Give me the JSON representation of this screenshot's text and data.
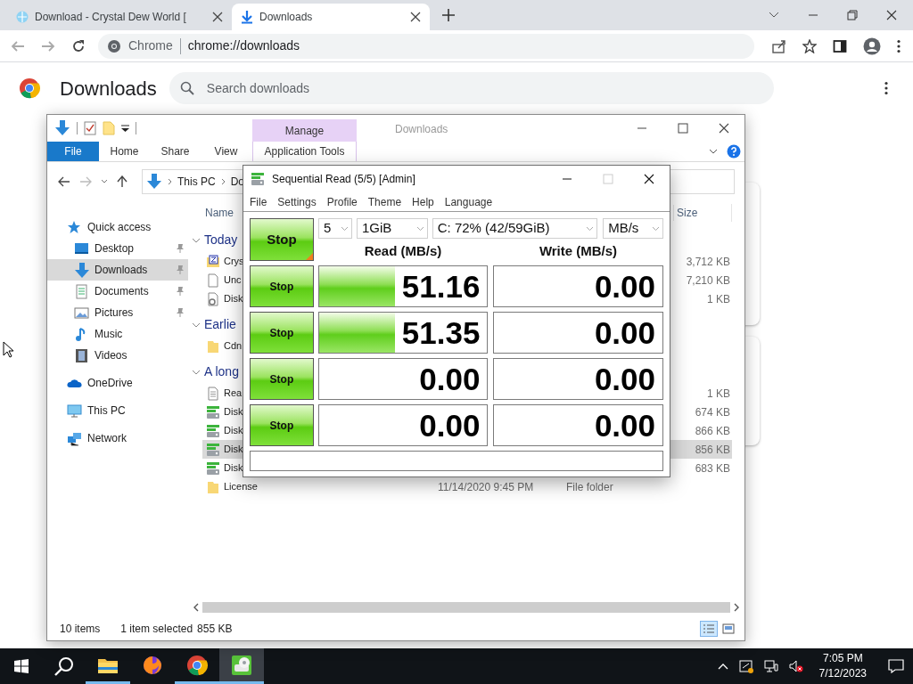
{
  "browser": {
    "tabs": [
      {
        "title": "Download - Crystal Dew World [",
        "kind": "site",
        "selected": false
      },
      {
        "title": "Downloads",
        "kind": "download",
        "selected": true
      }
    ],
    "omnibox": {
      "chip": "Chrome",
      "url": "chrome://downloads"
    },
    "page_title": "Downloads",
    "search": {
      "placeholder": "Search downloads"
    }
  },
  "explorer": {
    "title": "Downloads",
    "context_group": "Manage",
    "ribbon_tabs": [
      {
        "label": "File",
        "kind": "file"
      },
      {
        "label": "Home",
        "kind": "tab"
      },
      {
        "label": "Share",
        "kind": "tab"
      },
      {
        "label": "View",
        "kind": "tab"
      },
      {
        "label": "Application Tools",
        "kind": "context"
      }
    ],
    "breadcrumb": [
      "This PC",
      "Do"
    ],
    "nav": [
      {
        "label": "Quick access",
        "kind": "star",
        "selected": false,
        "children": [
          {
            "label": "Desktop",
            "kind": "desktop",
            "pinned": true,
            "selected": false
          },
          {
            "label": "Downloads",
            "kind": "download",
            "pinned": true,
            "selected": true
          },
          {
            "label": "Documents",
            "kind": "documents",
            "pinned": true,
            "selected": false
          },
          {
            "label": "Pictures",
            "kind": "pictures",
            "pinned": true,
            "selected": false
          },
          {
            "label": "Music",
            "kind": "music",
            "pinned": false,
            "selected": false
          },
          {
            "label": "Videos",
            "kind": "videos",
            "pinned": false,
            "selected": false
          }
        ]
      },
      {
        "label": "OneDrive",
        "kind": "cloud",
        "selected": false
      },
      {
        "label": "This PC",
        "kind": "pc",
        "selected": false
      },
      {
        "label": "Network",
        "kind": "network",
        "selected": false
      }
    ],
    "columns": [
      "Name",
      "Size"
    ],
    "groups": [
      {
        "label": "Today",
        "expanded": true,
        "files": [
          {
            "name": "Crys",
            "kind": "archive",
            "size": "3,712 KB",
            "selected": false
          },
          {
            "name": "Unc",
            "kind": "file",
            "size": "7,210 KB",
            "selected": false
          },
          {
            "name": "Disk",
            "kind": "config",
            "size": "1 KB",
            "selected": false
          }
        ]
      },
      {
        "label": "Earlie",
        "expanded": true,
        "files": [
          {
            "name": "Cdn",
            "kind": "folder",
            "selected": false
          }
        ]
      },
      {
        "label": "A long",
        "expanded": true,
        "files": [
          {
            "name": "Rea",
            "kind": "text",
            "size": "1 KB",
            "selected": false
          },
          {
            "name": "Disk",
            "kind": "app",
            "size": "674 KB",
            "selected": false
          },
          {
            "name": "Disk",
            "kind": "app",
            "size": "866 KB",
            "selected": false
          },
          {
            "name": "Disk",
            "kind": "app",
            "size": "856 KB",
            "selected": true
          },
          {
            "name": "Disk",
            "kind": "app",
            "size": "683 KB",
            "selected": false
          },
          {
            "name": "License",
            "kind": "folder",
            "date": "11/14/2020 9:45 PM",
            "type": "File folder",
            "selected": false
          }
        ]
      }
    ],
    "status": {
      "items": "10 items",
      "selection": "1 item selected",
      "size": "855 KB"
    },
    "views": [
      {
        "kind": "details",
        "selected": true
      },
      {
        "kind": "tiles",
        "selected": false
      }
    ]
  },
  "diskmark": {
    "title": "Sequential Read (5/5) [Admin]",
    "menu": [
      "File",
      "Settings",
      "Profile",
      "Theme",
      "Help",
      "Language"
    ],
    "all_button": "Stop",
    "count": "5",
    "size": "1GiB",
    "drive": "C: 72% (42/59GiB)",
    "unit": "MB/s",
    "read_header": "Read (MB/s)",
    "write_header": "Write (MB/s)",
    "rows": [
      {
        "button": "Stop",
        "read": {
          "value": "51.16",
          "level": 0.45
        },
        "write": {
          "value": "0.00"
        }
      },
      {
        "button": "Stop",
        "read": {
          "value": "51.35",
          "level": 0.45
        },
        "write": {
          "value": "0.00"
        }
      },
      {
        "button": "Stop",
        "read": {
          "value": "0.00"
        },
        "write": {
          "value": "0.00"
        }
      },
      {
        "button": "Stop",
        "read": {
          "value": "0.00"
        },
        "write": {
          "value": "0.00"
        }
      }
    ]
  },
  "taskbar": {
    "apps": [
      {
        "kind": "folder",
        "open": true,
        "selected": false
      },
      {
        "kind": "firefox",
        "open": false,
        "selected": false
      },
      {
        "kind": "chrome",
        "open": true,
        "selected": false
      },
      {
        "kind": "diskmark",
        "open": true,
        "selected": true
      }
    ],
    "time": "7:05 PM",
    "date": "7/12/2023"
  }
}
